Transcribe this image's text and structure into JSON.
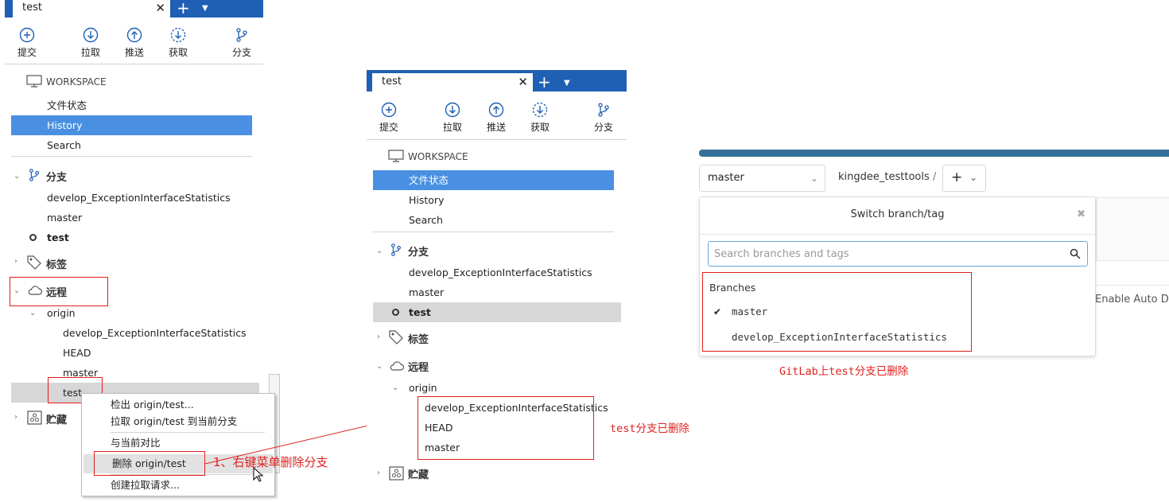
{
  "panel1": {
    "tab_title": "test",
    "toolbar": {
      "commit": "提交",
      "pull": "拉取",
      "push": "推送",
      "fetch": "获取",
      "branch": "分支"
    },
    "workspace": "WORKSPACE",
    "ws_items": [
      "文件状态",
      "History",
      "Search"
    ],
    "branches_label": "分支",
    "branches": [
      "develop_ExceptionInterfaceStatistics",
      "master",
      "test"
    ],
    "tags_label": "标签",
    "remote_label": "远程",
    "origin": "origin",
    "remote_items": [
      "develop_ExceptionInterfaceStatistics",
      "HEAD",
      "master",
      "test"
    ],
    "stash_label": "贮藏",
    "context_menu": [
      "检出 origin/test...",
      "拉取 origin/test 到当前分支",
      "与当前对比",
      "删除 origin/test",
      "创建拉取请求..."
    ]
  },
  "panel2": {
    "tab_title": "test",
    "toolbar": {
      "commit": "提交",
      "pull": "拉取",
      "push": "推送",
      "fetch": "获取",
      "branch": "分支"
    },
    "workspace": "WORKSPACE",
    "ws_items": [
      "文件状态",
      "History",
      "Search"
    ],
    "branches_label": "分支",
    "branches": [
      "develop_ExceptionInterfaceStatistics",
      "master",
      "test"
    ],
    "tags_label": "标签",
    "remote_label": "远程",
    "origin": "origin",
    "remote_items": [
      "develop_ExceptionInterfaceStatistics",
      "HEAD",
      "master"
    ],
    "stash_label": "贮藏"
  },
  "gitlab": {
    "branch_select": "master",
    "project": "kingdee_testtools",
    "slash": "/",
    "plus": "+",
    "dropdown_title": "Switch branch/tag",
    "search_placeholder": "Search branches and tags",
    "branches_header": "Branches",
    "branches": [
      "master",
      "develop_ExceptionInterfaceStatistics"
    ],
    "side_text": "Enable Auto De"
  },
  "annotations": {
    "step1": "1、右键菜单删除分支",
    "deleted_local": "test分支已删除",
    "deleted_gitlab": "GitLab上test分支已删除"
  },
  "colors": {
    "accent": "#1f5fb4",
    "highlight": "#4a90e2",
    "annotation": "#e0201e"
  }
}
